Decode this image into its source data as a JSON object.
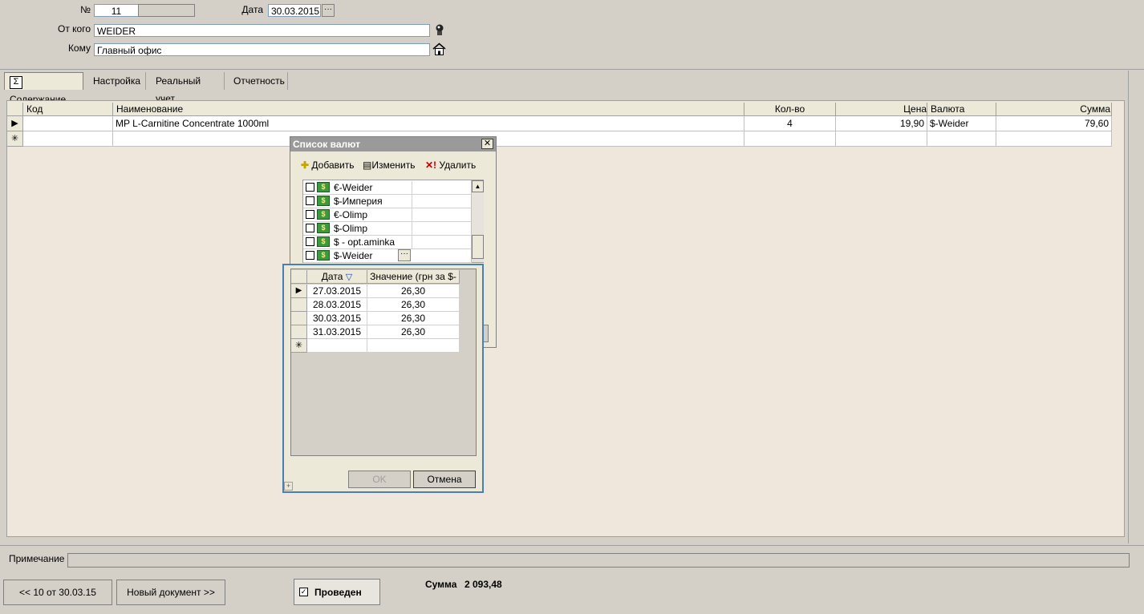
{
  "header": {
    "number_label": "№",
    "number_value": "11",
    "date_label": "Дата",
    "date_value": "30.03.2015",
    "from_label": "От кого",
    "from_value": "WEIDER",
    "to_label": "Кому",
    "to_value": "Главный офис"
  },
  "tabs": [
    "Содержание",
    "Настройка",
    "Реальный учет",
    "Отчетность"
  ],
  "grid": {
    "columns": [
      "Код",
      "Наименование",
      "Кол-во",
      "Цена",
      "Валюта",
      "Сумма"
    ],
    "rows": [
      {
        "code": "",
        "name": "MP L-Carnitine Concentrate 1000ml",
        "qty": "4",
        "price": "19,90",
        "currency": "$-Weider",
        "sum": "79,60"
      }
    ]
  },
  "currency_dialog": {
    "title": "Список валют",
    "toolbar": {
      "add": "Добавить",
      "edit": "Изменить",
      "delete": "Удалить"
    },
    "items": [
      "€-Weider",
      "$-Империя",
      "€-Olimp",
      "$-Olimp",
      "$ - opt.aminka",
      "$-Weider"
    ]
  },
  "rates_dialog": {
    "columns": [
      "Дата",
      "Значение (грн за $-"
    ],
    "rows": [
      {
        "date": "27.03.2015",
        "value": "26,30"
      },
      {
        "date": "28.03.2015",
        "value": "26,30"
      },
      {
        "date": "30.03.2015",
        "value": "26,30"
      },
      {
        "date": "31.03.2015",
        "value": "26,30"
      }
    ],
    "ok": "OK",
    "cancel": "Отмена"
  },
  "footer": {
    "note_label": "Примечание",
    "note_value": "",
    "prev_button": "<< 10 от 30.03.15",
    "new_button": "Новый документ >>",
    "posted_label": "Проведен",
    "sum_label": "Сумма",
    "sum_value": "2 093,48"
  },
  "icons": {
    "dots": "ellipsis-icon",
    "person": "person-icon",
    "home": "home-icon",
    "sigma": "sigma-icon"
  }
}
